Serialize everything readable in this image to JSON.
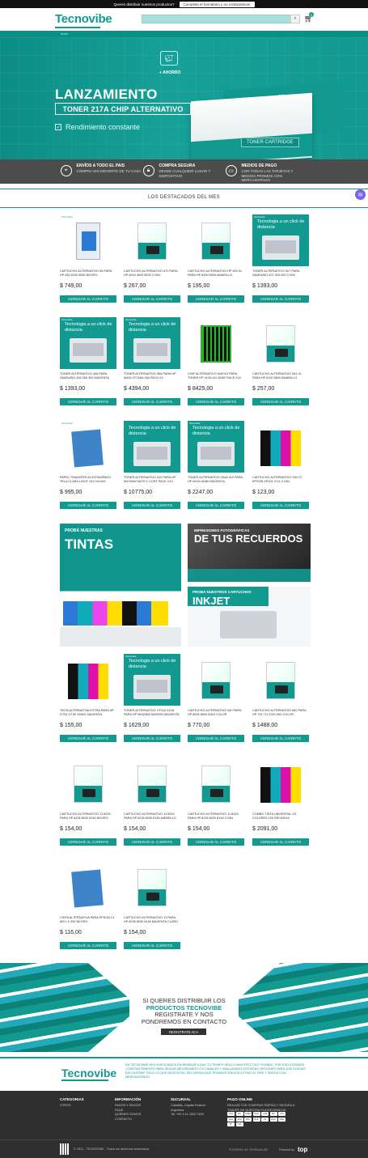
{
  "topbar": {
    "text": "Queres distribuir nuestros productos?",
    "link": "Completa el formulario y no contactamos!"
  },
  "header": {
    "logo": "Tecnovibe",
    "search_placeholder": "",
    "search_icon": "search-icon",
    "cart_icon": "cart-icon",
    "cart_count": "0"
  },
  "breadcrumb": "Inicio",
  "hero": {
    "savings": "+ AHORRO",
    "title": "LANZAMIENTO",
    "subtitle": "TONER 217A CHIP ALTERNATIVO",
    "feature": "Rendimiento constante",
    "box_brand": "Tecnovibe",
    "box_label": "TONER CARTRIDGE"
  },
  "features": [
    {
      "icon": "location-icon",
      "title": "ENVÍOS A TODO EL PAIS",
      "text": "COMPRA SIN MOVERTE DE TU CASA"
    },
    {
      "icon": "lock-icon",
      "title": "Compra segura",
      "text": "DESDE CUALQUIER LUGAR Y DISPOSITIVO"
    },
    {
      "icon": "card-icon",
      "title": "MEDIOS DE PAGO",
      "text": "CON TODAS LAS TARJETAS Y MEDIOS PROMOS CON MERCADOPAGO"
    }
  ],
  "section_title": "LOS DESTACADOS DEL MES",
  "add_to_cart": "AGREGAR AL CARRITO",
  "products": [
    {
      "name": "CARTUCHO ALTERNATIVO 56 PARA HP 450 5150 5550 NEGRO",
      "price": "$ 749,00",
      "img": "blister",
      "logo": "Tecnovibe"
    },
    {
      "name": "CARTUCHO ALTERNATIVO 670 PARA HP 4615 4625 5525 CYAN",
      "price": "$ 267,00",
      "img": "white"
    },
    {
      "name": "CARTUCHO ALTERNATIVO HP 920 XL PARA HP 6000 6500 AMARILLO",
      "price": "$ 195,00",
      "img": "white"
    },
    {
      "name": "TONER ALTERNATIVO 507 PARA SAMSUNG 407 325 320 CYAN",
      "price": "$ 1393,00",
      "img": "teal",
      "promo": "Tecnologia a un click de distancia",
      "logo": "Tecnovibe"
    },
    {
      "name": "TONER ALTERNATIVO 406 PARA SAMSUNG 406 365 300 MAGENTA",
      "price": "$ 1393,00",
      "img": "teal",
      "promo": "Tecnologia a un click de distancia",
      "logo": "Tecnovibe"
    },
    {
      "name": "TONER ALTERNATIVO 36A PARA HP M426 CF226A 26A PACK X3",
      "price": "$ 4394,00",
      "img": "teal",
      "promo": "Tecnologia a un click de distancia",
      "logo": "Tecnovibe"
    },
    {
      "name": "CHIP ALTERNATIVO NUEVO PARA TONER HP 410A 410 M452 PACK X10",
      "price": "$ 8425,00",
      "img": "chips"
    },
    {
      "name": "CARTUCHO ALTERNATIVO 951 XL PARA HP 8100 8600 AMARILLO",
      "price": "$ 257,00",
      "img": "white"
    },
    {
      "name": "PAPEL TRANSFER A4 ESTAMPADO TELA CLARA LIGHT X10 HOJAS",
      "price": "$ 995,00",
      "img": "paper",
      "logo": "Tecnovibe"
    },
    {
      "name": "TONER ALTERNATIVO 312 PARA HP M476NW M476 X CONT PACK X10",
      "price": "$ 10775,00",
      "img": "teal",
      "promo": "Tecnologia a un click de distancia"
    },
    {
      "name": "TONER ALTERNATIVO 204A 410 PARA HP M154 M180 MAGENTA",
      "price": "$ 2247,00",
      "img": "teal",
      "promo": "Tecnologia a un click de distancia",
      "logo": "Tecnovibe"
    },
    {
      "name": "CARTUCHO ALTERNATIVO 296 FC EPSON XP201 CO1 CYAN",
      "price": "$ 123,00",
      "img": "bottles"
    },
    {
      "name": "TINTA ALTERNATIVA EXTRA PARA HP GT51 GT52 100ML MAGENTA",
      "price": "$ 155,00",
      "img": "bottles"
    },
    {
      "name": "TONER ALTERNATIVO CF410 410A PARA HP M452NW M452DN MAGENTA",
      "price": "$ 1629,00",
      "img": "teal",
      "promo": "Tecnologia a un click de distancia",
      "logo": "Tecnovibe"
    },
    {
      "name": "CARTUCHO ALTERNATIVO 940 PARA HP 8000 8500 A910 COLOR",
      "price": "$ 770,00",
      "img": "white"
    },
    {
      "name": "CARTUCHO ALTERNATIVO 662 PARA HP 702 712 D2S D60 COLOR",
      "price": "$ 1488,00",
      "img": "white"
    },
    {
      "name": "CARTUCHO ALTERNATIVO 11 8315 PARA HP 8236 8030 8146 NEGRO",
      "price": "$ 154,00",
      "img": "white"
    },
    {
      "name": "CARTUCHO ALTERNATIVO 11 8315 PARA HP 8236 8030 8146 AMARILLO",
      "price": "$ 154,00",
      "img": "white"
    },
    {
      "name": "CARTUCHO ALTERNATIVO 11 8315 PARA HP 8236 8030 8146 CYAN",
      "price": "$ 154,00",
      "img": "white"
    },
    {
      "name": "COMBO TINTA UNIVERSAL X4 COLORES 100 RECARGA",
      "price": "$ 2091,00",
      "img": "bottles"
    },
    {
      "name": "CINTA ALTERNATIVA PARA EPSON LX 800 LX 300 NEGRO",
      "price": "$ 116,00",
      "img": "paper"
    },
    {
      "name": "CARTUCHO ALTERNATIVO 11 PARA HP 8236 8030 8146 MAGENTA CLARO",
      "price": "$ 154,00",
      "img": "white"
    }
  ],
  "banners": {
    "tintas_small": "PROBÁ NUESTRAS",
    "tintas_big": "TINTAS",
    "recuerdos_small": "IMPRESIONES FOTOGRÁFICAS",
    "recuerdos_big": "DE TUS RECUERDOS",
    "inkjet_small": "PROBÁ NUESTROS CARTUCHOS",
    "inkjet_big": "INKJET"
  },
  "distributor": {
    "line1": "SI QUERES DISTRIBUIR LOS",
    "line2": "PRODUCTOS TECNOVIBE",
    "line3": "REGISTRATE Y NOS",
    "line4": "PONDREMOS EN CONTACTO",
    "button": "REGISTRATE ACA"
  },
  "about": {
    "logo": "Tecnovibe",
    "text": "EN TECNOVIBE NOS ENFOCAMOS EN BRINDAR A QUE TU TIEMPO SEA LO MAS EFECTIVO POSIBLE, POR ESO ESTAMOS CONSTANTEMENTE PARA SEGUIR MEJORANDO LOS CANALES Y ANALIZANDO DISTINTAS OPCIONES PARA QUE PUEDAS ENCONTRAR TODO LO QUE NECESITAS, RECUERDA QUE TENEMOS ENVIOS A TODO EL PAIS Y PAGOS CON MERCADOPAGO"
  },
  "footer": {
    "categorias": {
      "title": "CATEGORIAS",
      "items": [
        "OTROS"
      ]
    },
    "informacion": {
      "title": "INFORMACIÓN",
      "items": [
        "PAGOS Y ENVÍOS",
        "FAQS",
        "QUIENES SOMOS",
        "CONTACTO"
      ]
    },
    "sucursal": {
      "title": "SUCURSAL",
      "items": [
        "Caballito, Capital Federal",
        "Argentina",
        "Tel: +54 9 11 3320 7428"
      ]
    },
    "pago": {
      "title": "PAGO ONLINE",
      "text": "REALIZÁ TUS COMPRAS RÁPIDA Y SEGURA A TRAVÉS DE NUESTRA PLATAFORMA DE MERCADOPAGO"
    },
    "pay_icons": [
      "VISA",
      "MC",
      "AMEX",
      "NAR",
      "CAB",
      "MP",
      "DIN",
      "ARG",
      "CEN",
      "PAG",
      "RAP",
      "ITA",
      "BAN",
      "MAE",
      "PF",
      "LNK"
    ],
    "copyright": "© 2021 - TECNOVIBE - Todos los derechos reservados",
    "powered": "POWERED BY TIENDANUBE",
    "powered_by": "Powered by",
    "brand": "top"
  }
}
